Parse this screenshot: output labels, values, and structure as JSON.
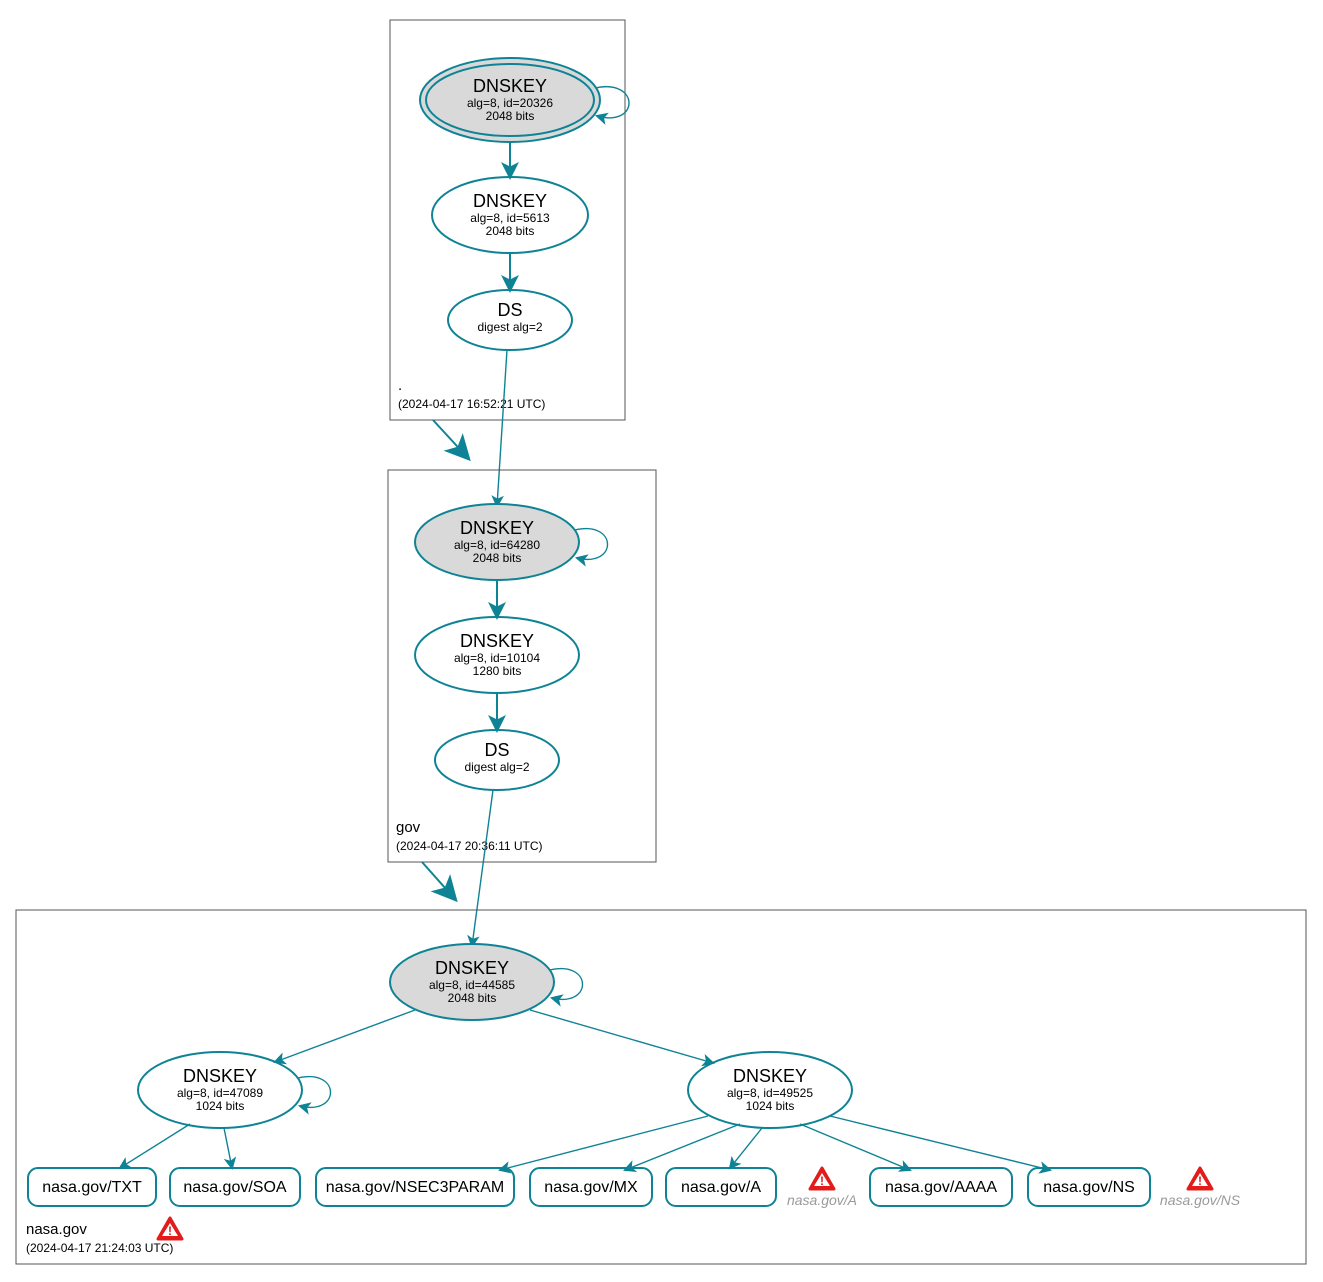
{
  "colors": {
    "stroke": "#0e8395",
    "ksk_fill": "#d9d9d9",
    "warn": "#e21b1b"
  },
  "zones": {
    "root": {
      "name": ".",
      "timestamp": "(2024-04-17 16:52:21 UTC)"
    },
    "gov": {
      "name": "gov",
      "timestamp": "(2024-04-17 20:36:11 UTC)"
    },
    "nasa": {
      "name": "nasa.gov",
      "timestamp": "(2024-04-17 21:24:03 UTC)"
    }
  },
  "root_ksk": {
    "title": "DNSKEY",
    "sub1": "alg=8, id=20326",
    "sub2": "2048 bits"
  },
  "root_zsk": {
    "title": "DNSKEY",
    "sub1": "alg=8, id=5613",
    "sub2": "2048 bits"
  },
  "root_ds": {
    "title": "DS",
    "sub1": "digest alg=2"
  },
  "gov_ksk": {
    "title": "DNSKEY",
    "sub1": "alg=8, id=64280",
    "sub2": "2048 bits"
  },
  "gov_zsk": {
    "title": "DNSKEY",
    "sub1": "alg=8, id=10104",
    "sub2": "1280 bits"
  },
  "gov_ds": {
    "title": "DS",
    "sub1": "digest alg=2"
  },
  "nasa_ksk": {
    "title": "DNSKEY",
    "sub1": "alg=8, id=44585",
    "sub2": "2048 bits"
  },
  "nasa_zsk1": {
    "title": "DNSKEY",
    "sub1": "alg=8, id=47089",
    "sub2": "1024 bits"
  },
  "nasa_zsk2": {
    "title": "DNSKEY",
    "sub1": "alg=8, id=49525",
    "sub2": "1024 bits"
  },
  "nasa_rr": {
    "txt": "nasa.gov/TXT",
    "soa": "nasa.gov/SOA",
    "nsec": "nasa.gov/NSEC3PARAM",
    "mx": "nasa.gov/MX",
    "a": "nasa.gov/A",
    "aaaa": "nasa.gov/AAAA",
    "ns": "nasa.gov/NS"
  },
  "ghost": {
    "a": "nasa.gov/A",
    "ns": "nasa.gov/NS"
  }
}
